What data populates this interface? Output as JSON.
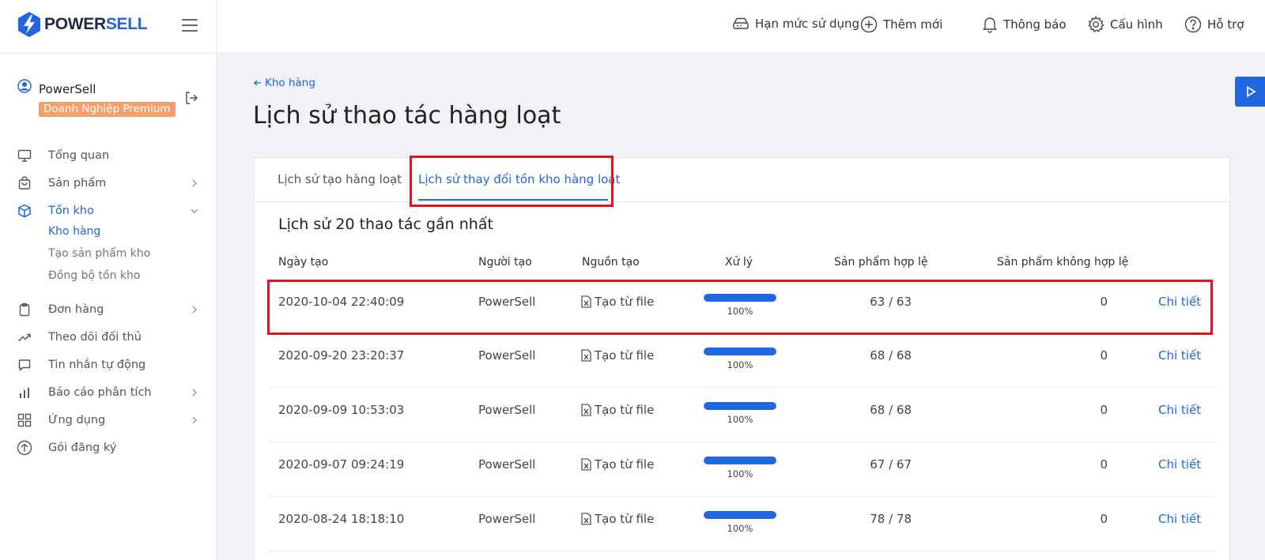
{
  "brand": {
    "logo_part1": "POWER",
    "logo_part2": "SELL",
    "accent": "#1f66e0"
  },
  "header": {
    "items": [
      {
        "label": "Hạn mức sử dụng",
        "icon": "usage-icon"
      },
      {
        "label": "Thêm mới",
        "icon": "plus-circle-icon"
      },
      {
        "label": "Thông báo",
        "icon": "bell-icon"
      },
      {
        "label": "Cấu hình",
        "icon": "gear-icon"
      },
      {
        "label": "Hỗ trợ",
        "icon": "help-icon"
      }
    ]
  },
  "user": {
    "name": "PowerSell",
    "plan": "Doanh Nghiệp Premium"
  },
  "sidebar": {
    "items": [
      {
        "label": "Tổng quan",
        "icon": "monitor-icon"
      },
      {
        "label": "Sản phẩm",
        "icon": "bag-icon"
      },
      {
        "label": "Tồn kho",
        "icon": "box-icon"
      },
      {
        "label": "Đơn hàng",
        "icon": "clipboard-icon"
      },
      {
        "label": "Theo dõi đối thủ",
        "icon": "trend-icon"
      },
      {
        "label": "Tin nhắn tự động",
        "icon": "chat-icon"
      },
      {
        "label": "Báo cáo phân tích",
        "icon": "bar-chart-icon"
      },
      {
        "label": "Ứng dụng",
        "icon": "apps-icon"
      },
      {
        "label": "Gói đăng ký",
        "icon": "upgrade-icon"
      }
    ],
    "sub_items": [
      "Kho hàng",
      "Tạo sản phẩm kho",
      "Đồng bộ tồn kho"
    ]
  },
  "breadcrumb": "Kho hàng",
  "page_title": "Lịch sử thao tác hàng loạt",
  "tabs": [
    "Lịch sử tạo hàng loạt",
    "Lịch sử thay đổi tồn kho hàng loạt"
  ],
  "section_title": "Lịch sử 20 thao tác gần nhất",
  "table": {
    "columns": [
      "Ngày tạo",
      "Người tạo",
      "Nguồn tạo",
      "Xử lý",
      "Sản phẩm hợp lệ",
      "Sản phẩm không hợp lệ"
    ],
    "rows": [
      {
        "date": "2020-10-04 22:40:09",
        "creator": "PowerSell",
        "source": "Tạo từ file",
        "progress": "100%",
        "valid": "63 / 63",
        "invalid": "0",
        "action": "Chi tiết"
      },
      {
        "date": "2020-09-20 23:20:37",
        "creator": "PowerSell",
        "source": "Tạo từ file",
        "progress": "100%",
        "valid": "68 / 68",
        "invalid": "0",
        "action": "Chi tiết"
      },
      {
        "date": "2020-09-09 10:53:03",
        "creator": "PowerSell",
        "source": "Tạo từ file",
        "progress": "100%",
        "valid": "68 / 68",
        "invalid": "0",
        "action": "Chi tiết"
      },
      {
        "date": "2020-09-07 09:24:19",
        "creator": "PowerSell",
        "source": "Tạo từ file",
        "progress": "100%",
        "valid": "67 / 67",
        "invalid": "0",
        "action": "Chi tiết"
      },
      {
        "date": "2020-08-24 18:18:10",
        "creator": "PowerSell",
        "source": "Tạo từ file",
        "progress": "100%",
        "valid": "78 / 78",
        "invalid": "0",
        "action": "Chi tiết"
      }
    ]
  }
}
